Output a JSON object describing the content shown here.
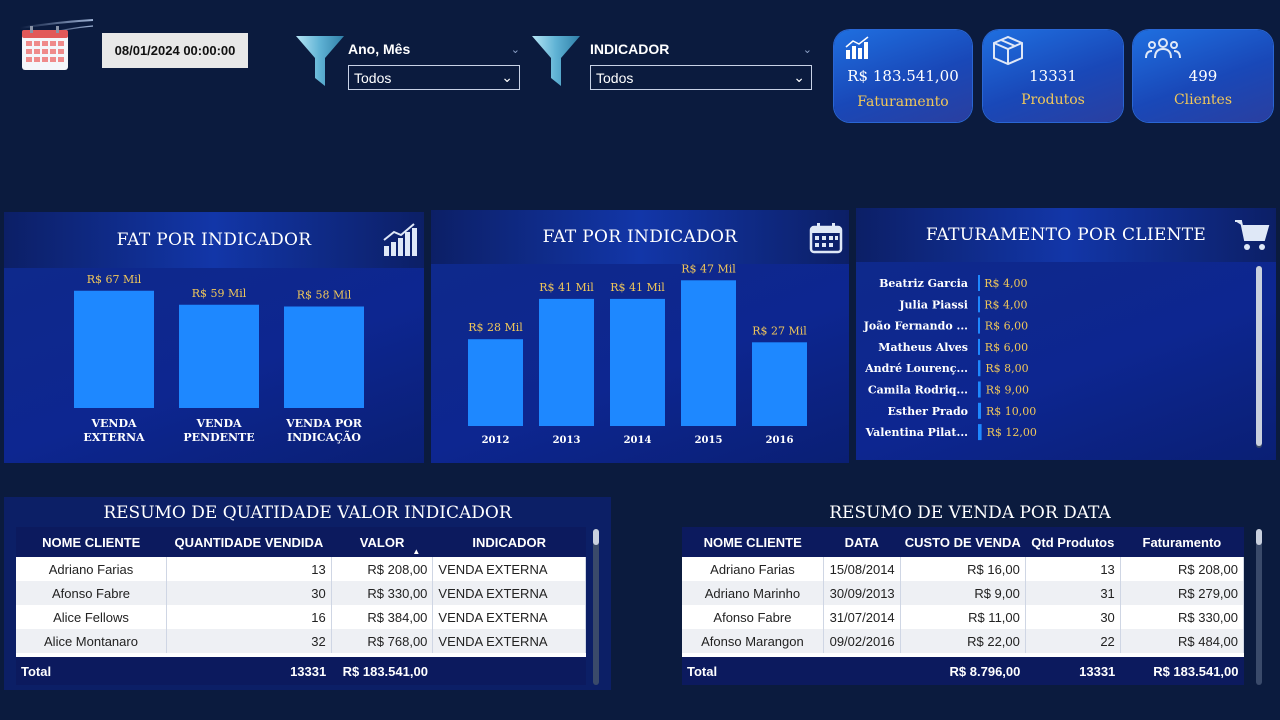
{
  "date_display": "08/01/2024 00:00:00",
  "filters": [
    {
      "title": "Ano, Mês",
      "selected": "Todos"
    },
    {
      "title": "INDICADOR",
      "selected": "Todos"
    }
  ],
  "kpis": [
    {
      "value": "R$ 183.541,00",
      "label": "Faturamento",
      "icon": "bar-chart-icon"
    },
    {
      "value": "13331",
      "label": "Produtos",
      "icon": "box-icon"
    },
    {
      "value": "499",
      "label": "Clientes",
      "icon": "users-icon"
    }
  ],
  "chart1": {
    "title": "FAT POR INDICADOR",
    "chart_data": {
      "type": "bar",
      "categories": [
        "VENDA EXTERNA",
        "VENDA PENDENTE",
        "VENDA POR INDICAÇÃO"
      ],
      "category_lines": [
        [
          "VENDA",
          "EXTERNA"
        ],
        [
          "VENDA",
          "PENDENTE"
        ],
        [
          "VENDA POR",
          "INDICAÇÃO"
        ]
      ],
      "values": [
        67,
        59,
        58
      ],
      "data_labels": [
        "R$ 67 Mil",
        "R$ 59 Mil",
        "R$ 58 Mil"
      ],
      "color": "#1e88ff"
    }
  },
  "chart2": {
    "title": "FAT POR INDICADOR",
    "chart_data": {
      "type": "bar",
      "categories": [
        "2012",
        "2013",
        "2014",
        "2015",
        "2016"
      ],
      "values": [
        28,
        41,
        41,
        47,
        27
      ],
      "data_labels": [
        "R$ 28 Mil",
        "R$ 41 Mil",
        "R$ 41 Mil",
        "R$ 47 Mil",
        "R$ 27 Mil"
      ],
      "color": "#1e88ff"
    }
  },
  "chart3": {
    "title": "FATURAMENTO POR CLIENTE",
    "chart_data": {
      "type": "bar",
      "categories": [
        "Beatriz Garcia",
        "Julia Piassi",
        "João Fernando ...",
        "Matheus Alves",
        "André Lourenç...",
        "Camila Rodriq...",
        "Esther Prado",
        "Valentina Pilat..."
      ],
      "values": [
        4,
        4,
        6,
        6,
        8,
        9,
        10,
        12
      ],
      "data_labels": [
        "R$ 4,00",
        "R$ 4,00",
        "R$ 6,00",
        "R$ 6,00",
        "R$ 8,00",
        "R$ 9,00",
        "R$ 10,00",
        "R$ 12,00"
      ],
      "color": "#1e88ff"
    }
  },
  "table1": {
    "title": "RESUMO DE QUATIDADE VALOR INDICADOR",
    "columns": [
      "NOME CLIENTE",
      "QUANTIDADE VENDIDA",
      "VALOR",
      "INDICADOR"
    ],
    "rows": [
      [
        "Adriano Farias",
        "13",
        "R$ 208,00",
        "VENDA EXTERNA"
      ],
      [
        "Afonso Fabre",
        "30",
        "R$ 330,00",
        "VENDA EXTERNA"
      ],
      [
        "Alice Fellows",
        "16",
        "R$ 384,00",
        "VENDA EXTERNA"
      ],
      [
        "Alice Montanaro",
        "32",
        "R$ 768,00",
        "VENDA EXTERNA"
      ]
    ],
    "total": [
      "Total",
      "13331",
      "R$ 183.541,00",
      ""
    ]
  },
  "table2": {
    "title": "RESUMO DE VENDA POR DATA",
    "columns": [
      "NOME CLIENTE",
      "DATA",
      "CUSTO DE VENDA",
      "Qtd Produtos",
      "Faturamento"
    ],
    "rows": [
      [
        "Adriano Farias",
        "15/08/2014",
        "R$ 16,00",
        "13",
        "R$ 208,00"
      ],
      [
        "Adriano Marinho",
        "30/09/2013",
        "R$ 9,00",
        "31",
        "R$ 279,00"
      ],
      [
        "Afonso Fabre",
        "31/07/2014",
        "R$ 11,00",
        "30",
        "R$ 330,00"
      ],
      [
        "Afonso Marangon",
        "09/02/2016",
        "R$ 22,00",
        "22",
        "R$ 484,00"
      ]
    ],
    "total": [
      "Total",
      "",
      "R$ 8.796,00",
      "13331",
      "R$ 183.541,00"
    ]
  }
}
